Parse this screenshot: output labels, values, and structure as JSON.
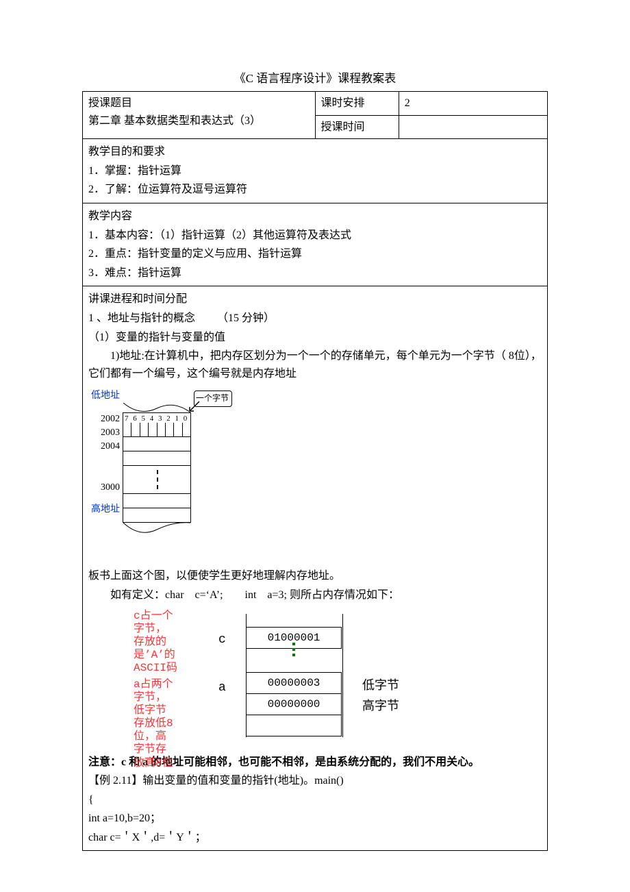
{
  "title": "《C 语言程序设计》课程教案表",
  "row1": {
    "topic_label": "授课题目",
    "topic_value": "第二章 基本数据类型和表达式（3）",
    "hours_label": "课时安排",
    "hours_value": "2",
    "time_label": "授课时间",
    "time_value": ""
  },
  "objectives": {
    "heading": "教学目的和要求",
    "items": [
      "1．掌握：指针运算",
      "2．了解：位运算符及逗号运算符"
    ]
  },
  "content": {
    "heading": "教学内容",
    "items": [
      "1．基本内容：（1）指针运算（2）其他运算符及表达式",
      "2．重点：指针变量的定义与应用、指针运算",
      "3．难点：指针运算"
    ]
  },
  "process": {
    "heading": "讲课进程和时间分配",
    "sec1_title": "1 、地址与指针的概念  （15 分钟）",
    "sec1_sub1": "（1）变量的指针与变量的值",
    "sec1_addr": "  1)地址:在计算机中，把内存区划分为一个一个的存储单元，每个单元为一个字节（ 8位），它们都有一个编号，这个编号就是内存地址",
    "diagram1": {
      "low_addr": "低地址",
      "high_addr": "高地址",
      "bits": "7 6 5 4 3 2 1 0",
      "rows": [
        "2002",
        "2003",
        "2004"
      ],
      "gap_row": "3000",
      "one_byte": "一个字节"
    },
    "after_diag1_line1": "板书上面这个图，以便使学生更好地理解内存地址。",
    "after_diag1_line2": "  如有定义：char c=‘A’;  int a=3;  则所占内存情况如下：",
    "diagram2": {
      "c_note": "c占一个\n字节，\n存放的\n是’A’的\nASCII码",
      "a_note": "a占两个\n字节，\n低字节\n存放低8\n位，高\n字节存\n放高8位",
      "c_var": "c",
      "a_var": "a",
      "cells": [
        "01000001",
        "",
        "00000003",
        "00000000",
        ""
      ],
      "low_byte": "低字节",
      "high_byte": "高字节"
    },
    "note_bold": "注意：c 和 a 的地址可能相邻，也可能不相邻，是由系统分配的，我们不用关心。",
    "example_head": "【例 2.11】输出变量的值和变量的指针(地址)。main()",
    "code": [
      "{",
      " int a=10,b=20；",
      " char c=＇X＇,d=＇Y＇；"
    ]
  }
}
